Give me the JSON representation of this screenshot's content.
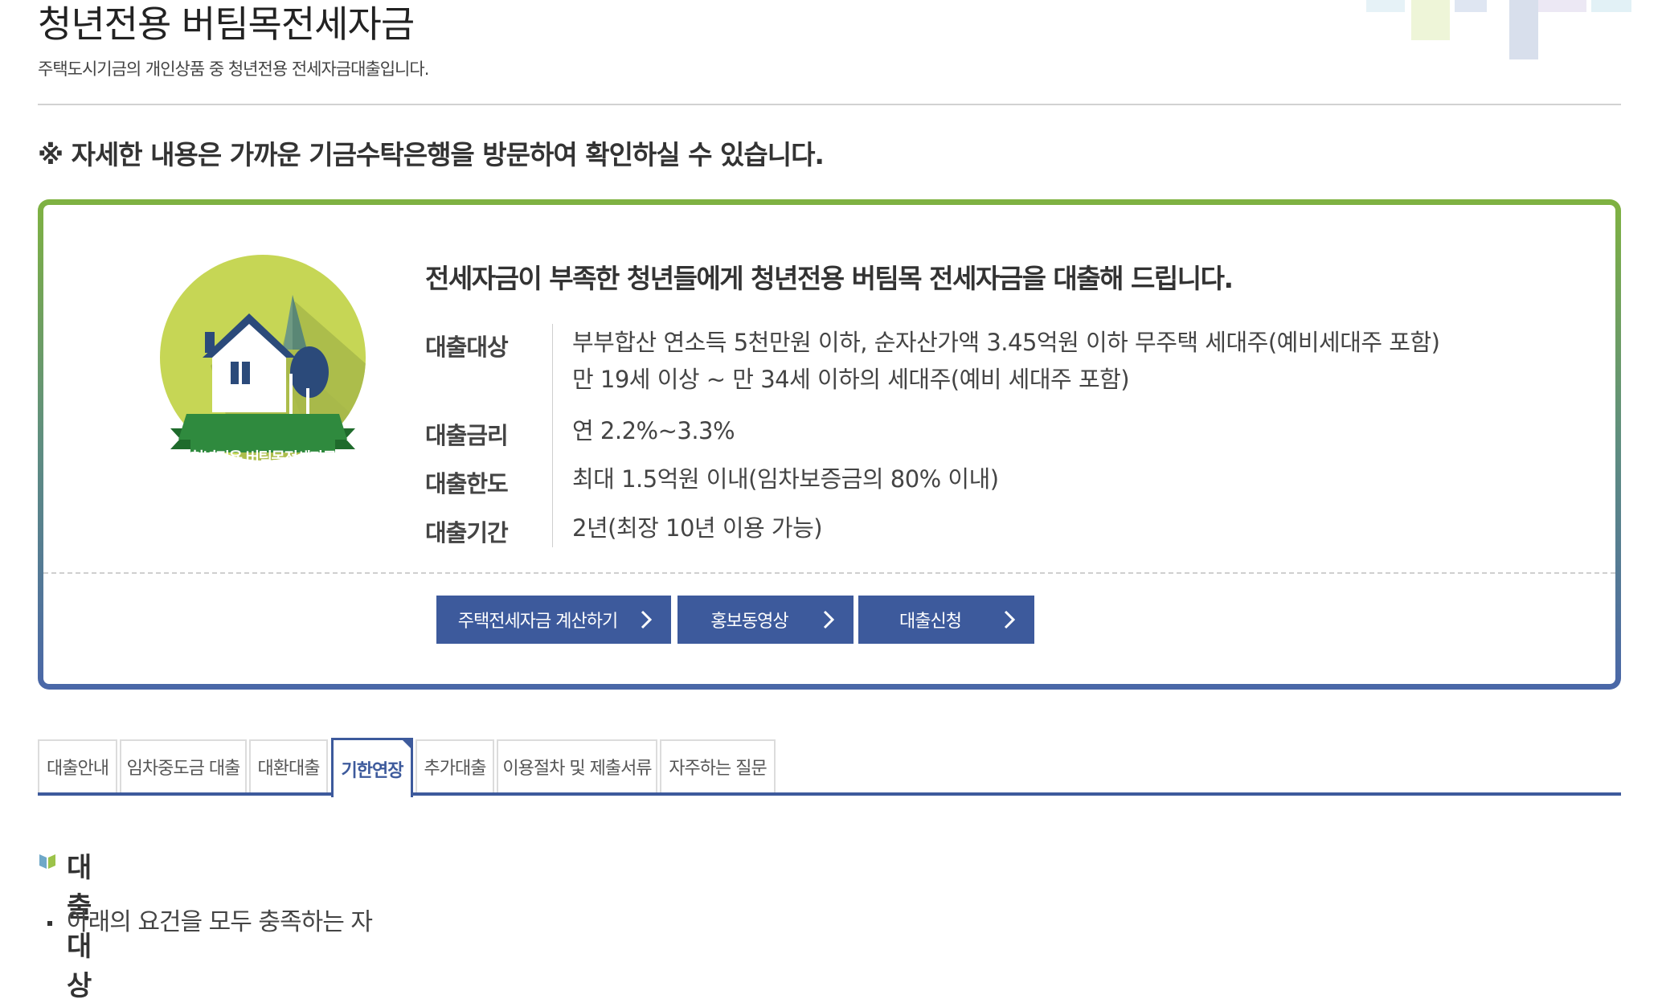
{
  "page": {
    "title": "청년전용 버팀목전세자금",
    "subtitle": "주택도시기금의 개인상품 중 청년전용 전세자금대출입니다.",
    "notice": "※ 자세한 내용은 가까운 기금수탁은행을 방문하여 확인하실 수 있습니다."
  },
  "product": {
    "badge_label": "청년전용 버팀목전세자금",
    "headline": "전세자금이 부족한 청년들에게 청년전용 버팀목 전세자금을 대출해 드립니다.",
    "rows": [
      {
        "label": "대출대상",
        "lines": [
          "부부합산 연소득 5천만원 이하, 순자산가액 3.45억원 이하 무주택 세대주(예비세대주 포함)",
          "만 19세 이상 ~ 만 34세 이하의 세대주(예비 세대주 포함)"
        ]
      },
      {
        "label": "대출금리",
        "lines": [
          "연 2.2%~3.3%"
        ]
      },
      {
        "label": "대출한도",
        "lines": [
          "최대 1.5억원 이내(임차보증금의 80% 이내)"
        ]
      },
      {
        "label": "대출기간",
        "lines": [
          "2년(최장 10년 이용 가능)"
        ]
      }
    ],
    "buttons": {
      "calculator": "주택전세자금 계산하기",
      "video": "홍보동영상",
      "apply": "대출신청"
    }
  },
  "tabs": [
    {
      "label": "대출안내"
    },
    {
      "label": "임차중도금 대출"
    },
    {
      "label": "대환대출"
    },
    {
      "label": "기한연장",
      "active": true
    },
    {
      "label": "추가대출"
    },
    {
      "label": "이용절차 및 제출서류"
    },
    {
      "label": "자주하는 질문"
    }
  ],
  "section": {
    "title": "대출대상",
    "bullet": "아래의 요건을 모두 충족하는 자"
  },
  "colors": {
    "brand_blue": "#3d5a9c",
    "box_green": "#7fb241",
    "badge_lime": "#c6d655",
    "badge_ribbon": "#2f8a3e"
  }
}
